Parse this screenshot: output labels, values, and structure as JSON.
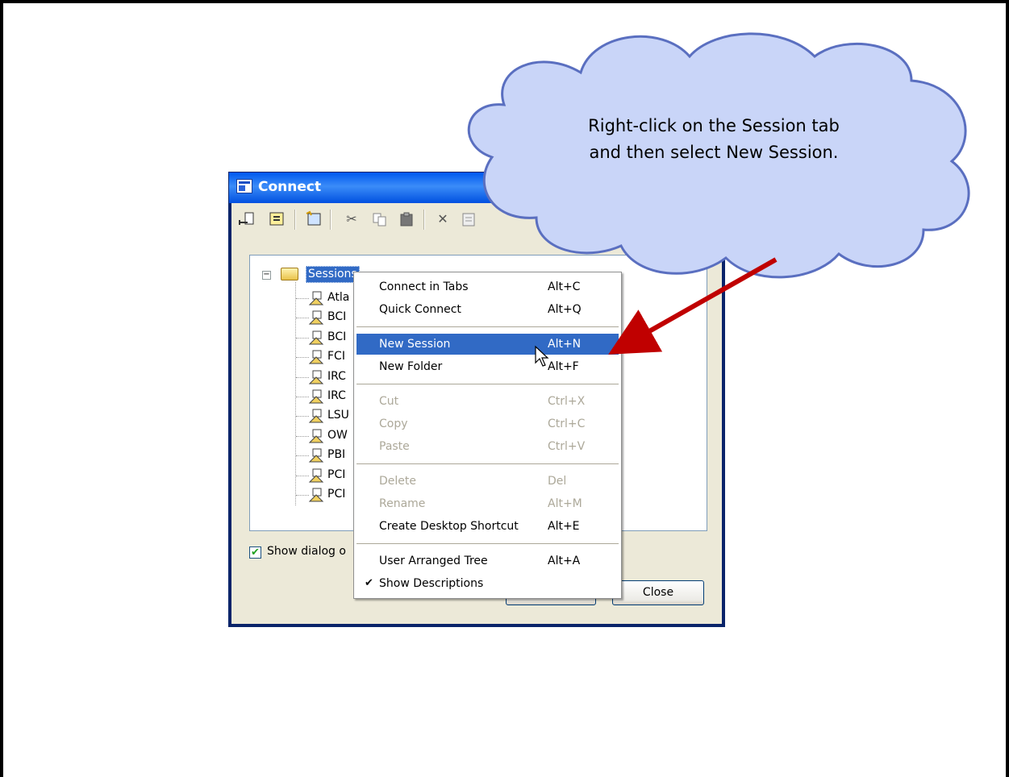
{
  "dialog": {
    "title": "Connect",
    "toolbar_icons": [
      "connect-icon",
      "quick-connect-icon",
      "new-session-icon",
      "cut-icon",
      "copy-icon",
      "paste-icon",
      "delete-icon",
      "properties-icon"
    ],
    "tree": {
      "root_label": "Sessions",
      "sessions": [
        "Atla",
        "BCI",
        "BCI",
        "FCI",
        "IRC",
        "IRC",
        "LSU",
        "OW",
        "PBI",
        "PCI",
        "PCI"
      ]
    },
    "checkbox_label": "Show dialog o",
    "close_button": "Close"
  },
  "context_menu": {
    "items": [
      {
        "label": "Connect in Tabs",
        "shortcut": "Alt+C",
        "state": "normal"
      },
      {
        "label": "Quick Connect",
        "shortcut": "Alt+Q",
        "state": "normal"
      },
      {
        "label": "New Session",
        "shortcut": "Alt+N",
        "state": "highlighted"
      },
      {
        "label": "New Folder",
        "shortcut": "Alt+F",
        "state": "normal"
      },
      {
        "label": "Cut",
        "shortcut": "Ctrl+X",
        "state": "disabled"
      },
      {
        "label": "Copy",
        "shortcut": "Ctrl+C",
        "state": "disabled"
      },
      {
        "label": "Paste",
        "shortcut": "Ctrl+V",
        "state": "disabled"
      },
      {
        "label": "Delete",
        "shortcut": "Del",
        "state": "disabled"
      },
      {
        "label": "Rename",
        "shortcut": "Alt+M",
        "state": "disabled"
      },
      {
        "label": "Create Desktop Shortcut",
        "shortcut": "Alt+E",
        "state": "normal"
      },
      {
        "label": "User Arranged Tree",
        "shortcut": "Alt+A",
        "state": "normal"
      },
      {
        "label": "Show Descriptions",
        "shortcut": "",
        "state": "checked"
      }
    ]
  },
  "callout": {
    "line1": "Right-click on the Session tab",
    "line2": "and then select New Session."
  },
  "colors": {
    "highlight": "#316AC5",
    "arrow": "#C00000",
    "cloud_fill": "#C9D5F8",
    "cloud_stroke": "#5A6FC0"
  }
}
